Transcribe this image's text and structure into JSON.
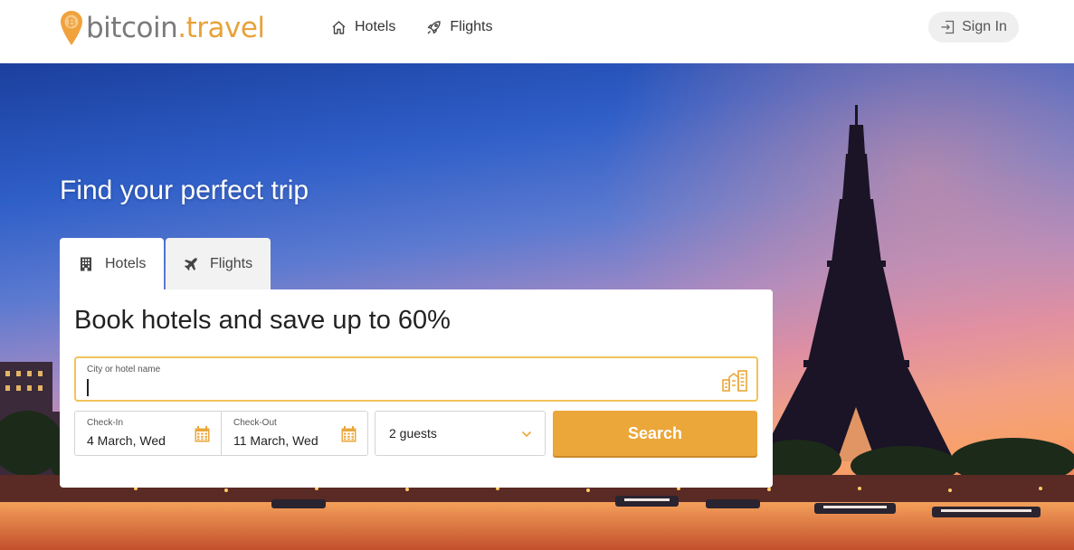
{
  "header": {
    "logo": {
      "word": "bitcoin",
      "dot": ".",
      "tld": "travel"
    },
    "nav": [
      {
        "label": "Hotels",
        "icon": "home-icon"
      },
      {
        "label": "Flights",
        "icon": "rocket-icon"
      }
    ],
    "signin_label": "Sign In"
  },
  "hero": {
    "title": "Find your perfect trip"
  },
  "tabs": [
    {
      "label": "Hotels",
      "icon": "building-icon",
      "active": true
    },
    {
      "label": "Flights",
      "icon": "plane-icon",
      "active": false
    }
  ],
  "search_panel": {
    "title": "Book hotels and save up to 60%",
    "city": {
      "label": "City or hotel name",
      "value": ""
    },
    "checkin": {
      "label": "Check-In",
      "value": "4 March, Wed"
    },
    "checkout": {
      "label": "Check-Out",
      "value": "11 March, Wed"
    },
    "guests": {
      "value": "2 guests"
    },
    "search_label": "Search"
  },
  "colors": {
    "accent": "#eba73a",
    "focus_border": "#f0c35a",
    "logo_grey": "#7a7a7a",
    "logo_orange": "#e8a23a"
  }
}
